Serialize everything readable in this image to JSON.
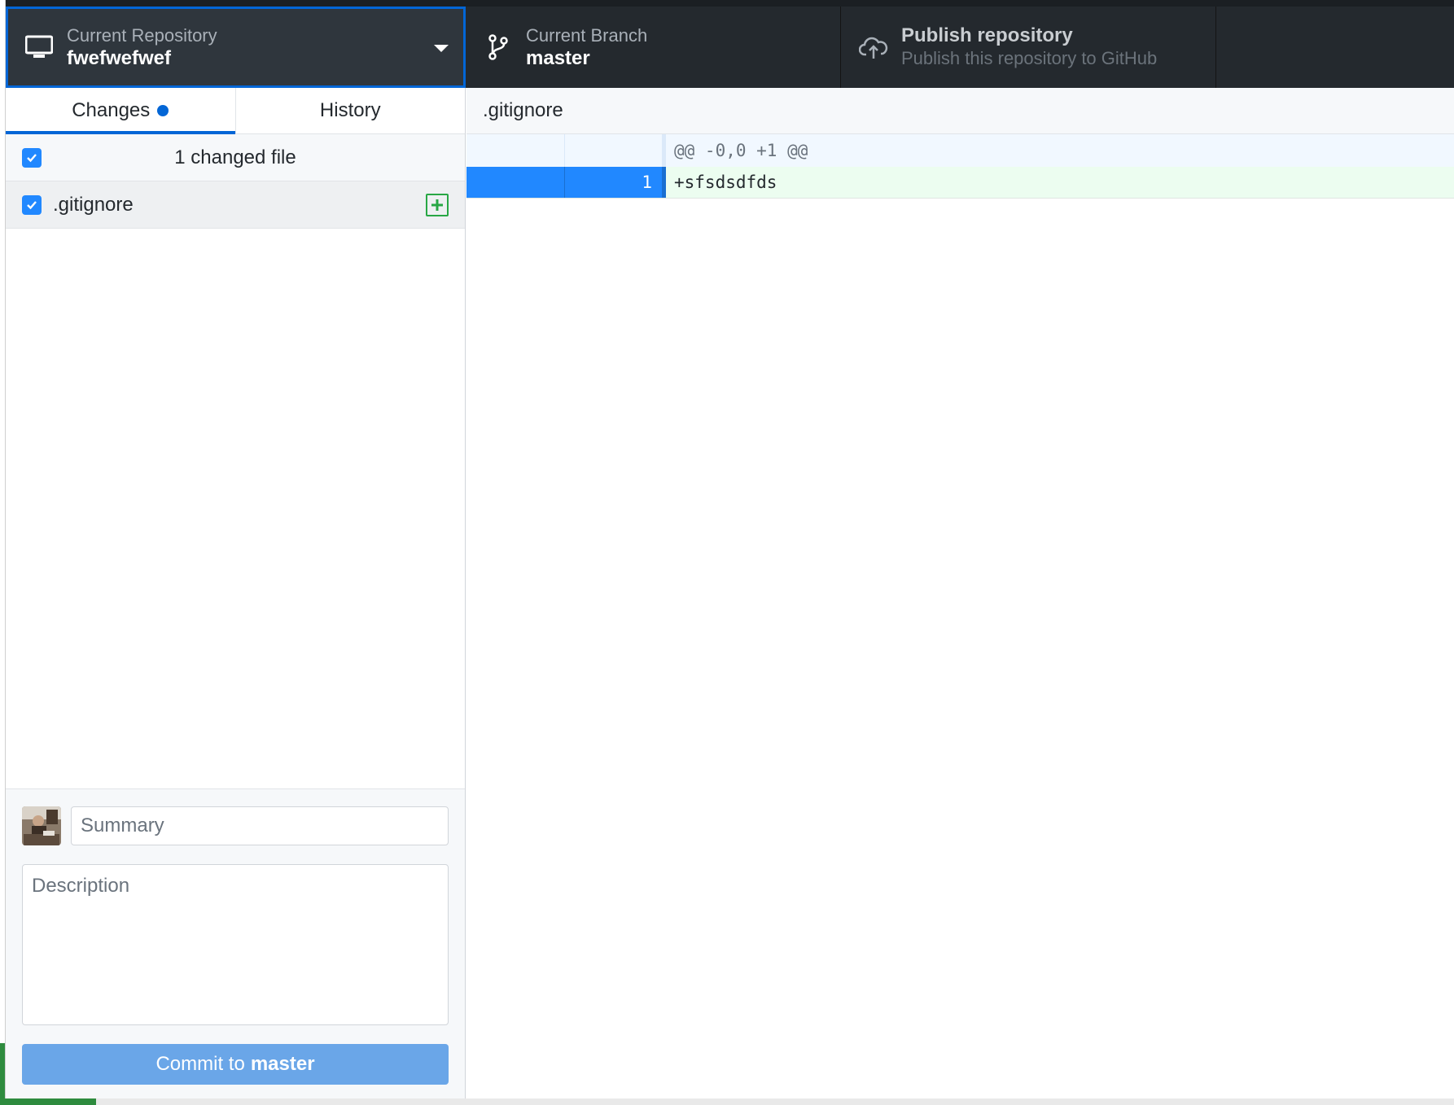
{
  "toolbar": {
    "repository": {
      "label": "Current Repository",
      "value": "fwefwefwef"
    },
    "branch": {
      "label": "Current Branch",
      "value": "master"
    },
    "publish": {
      "label": "Publish repository",
      "description": "Publish this repository to GitHub"
    }
  },
  "sidebar": {
    "tabs": [
      {
        "label": "Changes",
        "active": true
      },
      {
        "label": "History",
        "active": false
      }
    ],
    "changes_header": "1 changed file",
    "files": [
      {
        "name": ".gitignore",
        "checked": true,
        "status": "added"
      }
    ]
  },
  "commit": {
    "summary_placeholder": "Summary",
    "description_placeholder": "Description",
    "button_prefix": "Commit to",
    "button_branch": "master"
  },
  "diff": {
    "file": ".gitignore",
    "hunk_header": "@@ -0,0 +1 @@",
    "lines": [
      {
        "old_num": "",
        "new_num": "1",
        "text": "+sfsdsdfds",
        "type": "added"
      }
    ]
  },
  "colors": {
    "accent": "#0366d6",
    "toolbar_bg": "#24292e",
    "added_bg": "#ecfdf0",
    "selected_gutter": "#2188ff",
    "commit_button": "#6aa6e8"
  }
}
